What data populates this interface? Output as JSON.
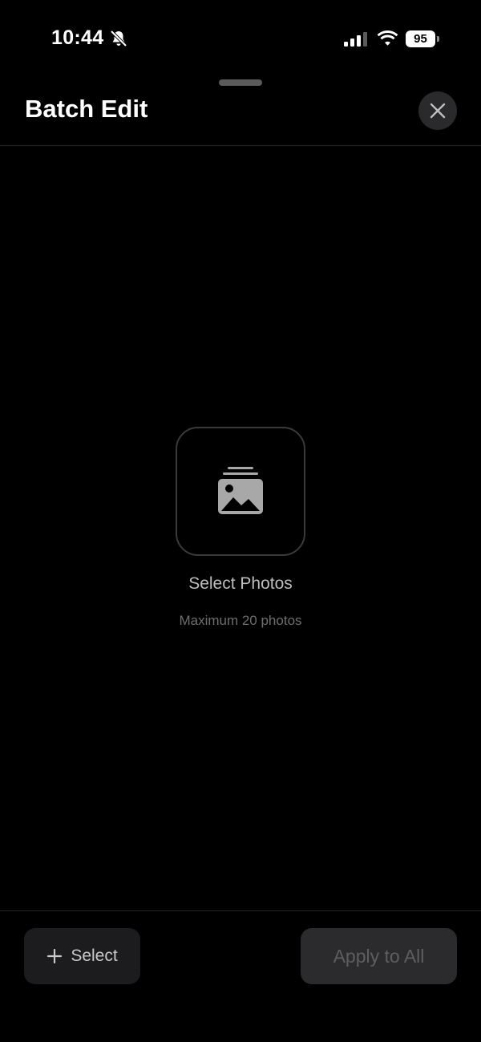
{
  "status_bar": {
    "time": "10:44",
    "battery": "95"
  },
  "header": {
    "title": "Batch Edit"
  },
  "empty_state": {
    "title": "Select Photos",
    "subtitle": "Maximum 20 photos",
    "icon": "photo-stack-icon"
  },
  "footer": {
    "select_label": "Select",
    "apply_label": "Apply to All"
  },
  "colors": {
    "background": "#000000",
    "surface": "#1c1c1e",
    "disabled_text": "#5e5e60"
  }
}
